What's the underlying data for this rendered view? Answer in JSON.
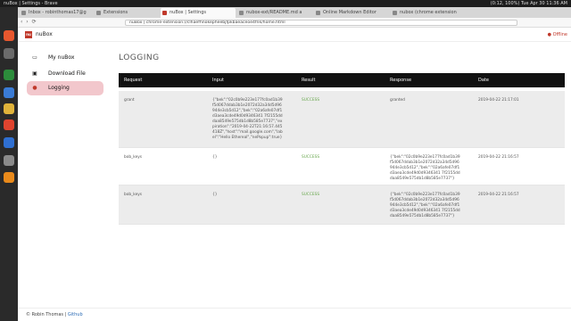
{
  "system": {
    "window_title": "nuBox | Settings - Brave",
    "status": "(0:12, 100%)  Tue Apr 30 11:36 AM"
  },
  "tabs": [
    {
      "label": "Inbox - robinthomas17@g",
      "active": false
    },
    {
      "label": "Extensions",
      "active": false
    },
    {
      "label": "nuBox | Settings",
      "active": true
    },
    {
      "label": "nubox-ext/README.md a",
      "active": false
    },
    {
      "label": "Online Markdown Editor",
      "active": false
    },
    {
      "label": "nubox (chrome extension",
      "active": false
    }
  ],
  "address": {
    "url": "nuBox | chrome-extension://clhaefhnokepheebjfpkbaeaceoe4fnk/home.html"
  },
  "app": {
    "logo": "nu",
    "name": "nuBox",
    "status": "Offline"
  },
  "sidebar": {
    "items": [
      {
        "label": "My nuBox",
        "icon": "monitor-icon",
        "glyph": "▭"
      },
      {
        "label": "Download File",
        "icon": "download-icon",
        "glyph": "▣"
      },
      {
        "label": "Logging",
        "icon": "alert-icon",
        "glyph": "●"
      }
    ]
  },
  "page": {
    "title": "LOGGING"
  },
  "table": {
    "headers": [
      "Request",
      "Input",
      "Result",
      "Response",
      "Date"
    ],
    "rows": [
      {
        "request": "grant",
        "input": "{\"bek\":\"02c0b9e223e177fc0ad1b39f5d067ddab3b1e2072d32a34d5d96944e3cb5d12\",\"bek\":\"02a6afe07df1d3aea3cde49d0d9346341 7f2155dddaa8549e575db1d8b585e7737\",\"expiration\":\"2019-04-22T21:16:57.445418Z\",\"host\":\"mail.google.com\",\"label\":\"Hello Ethereal\",\"nePopup\":true}",
        "result": "SUCCESS",
        "response": "granted",
        "date": "2019-04-22 21:17:01"
      },
      {
        "request": "bob_keys",
        "input": "{}",
        "result": "SUCCESS",
        "response": "{\"bek\":\"02c0b9e223e177fc0ad1b39f5d067ddab3b1e2072d32a34d5d96944e3cb5d12\",\"bek\":\"02a6afe07df1d3aea3cde49d0d9346341 7f2155dddaa8549e575db1d8b585e7737\"}",
        "date": "2019-04-22 21:16:57"
      },
      {
        "request": "bob_keys",
        "input": "{}",
        "result": "SUCCESS",
        "response": "{\"bek\":\"02c0b9e223e177fc0ad1b39f5d067ddab3b1e2072d32a34d5d96944e3cb5d12\",\"bek\":\"02a6afe07df1d3aea3cde49d0d9346341 7f2155dddaa8549e575db1d8b585e7737\"}",
        "date": "2019-04-22 21:16:57"
      }
    ]
  },
  "footer": {
    "copyright": "© Robin Thomas | ",
    "link": "Github"
  },
  "colors": {
    "accent": "#c0392b",
    "active_nav": "#f2c7cc",
    "success": "#6aa84f",
    "table_header": "#111111"
  }
}
